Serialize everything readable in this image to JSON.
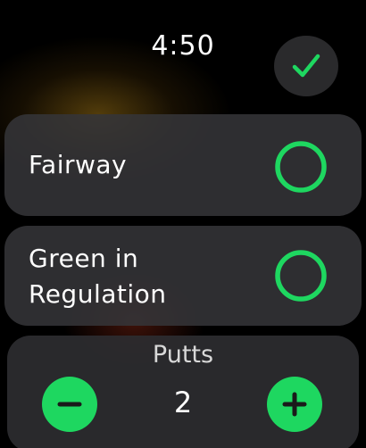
{
  "status_bar": {
    "time": "4:50"
  },
  "confirm": {
    "icon": "checkmark-icon"
  },
  "rows": [
    {
      "label": "Fairway",
      "checked": false
    },
    {
      "label": "Green in Regulation",
      "checked": false
    }
  ],
  "putts": {
    "title": "Putts",
    "value": "2"
  },
  "colors": {
    "accent": "#1ed760",
    "card": "#343438",
    "background": "#000000"
  }
}
